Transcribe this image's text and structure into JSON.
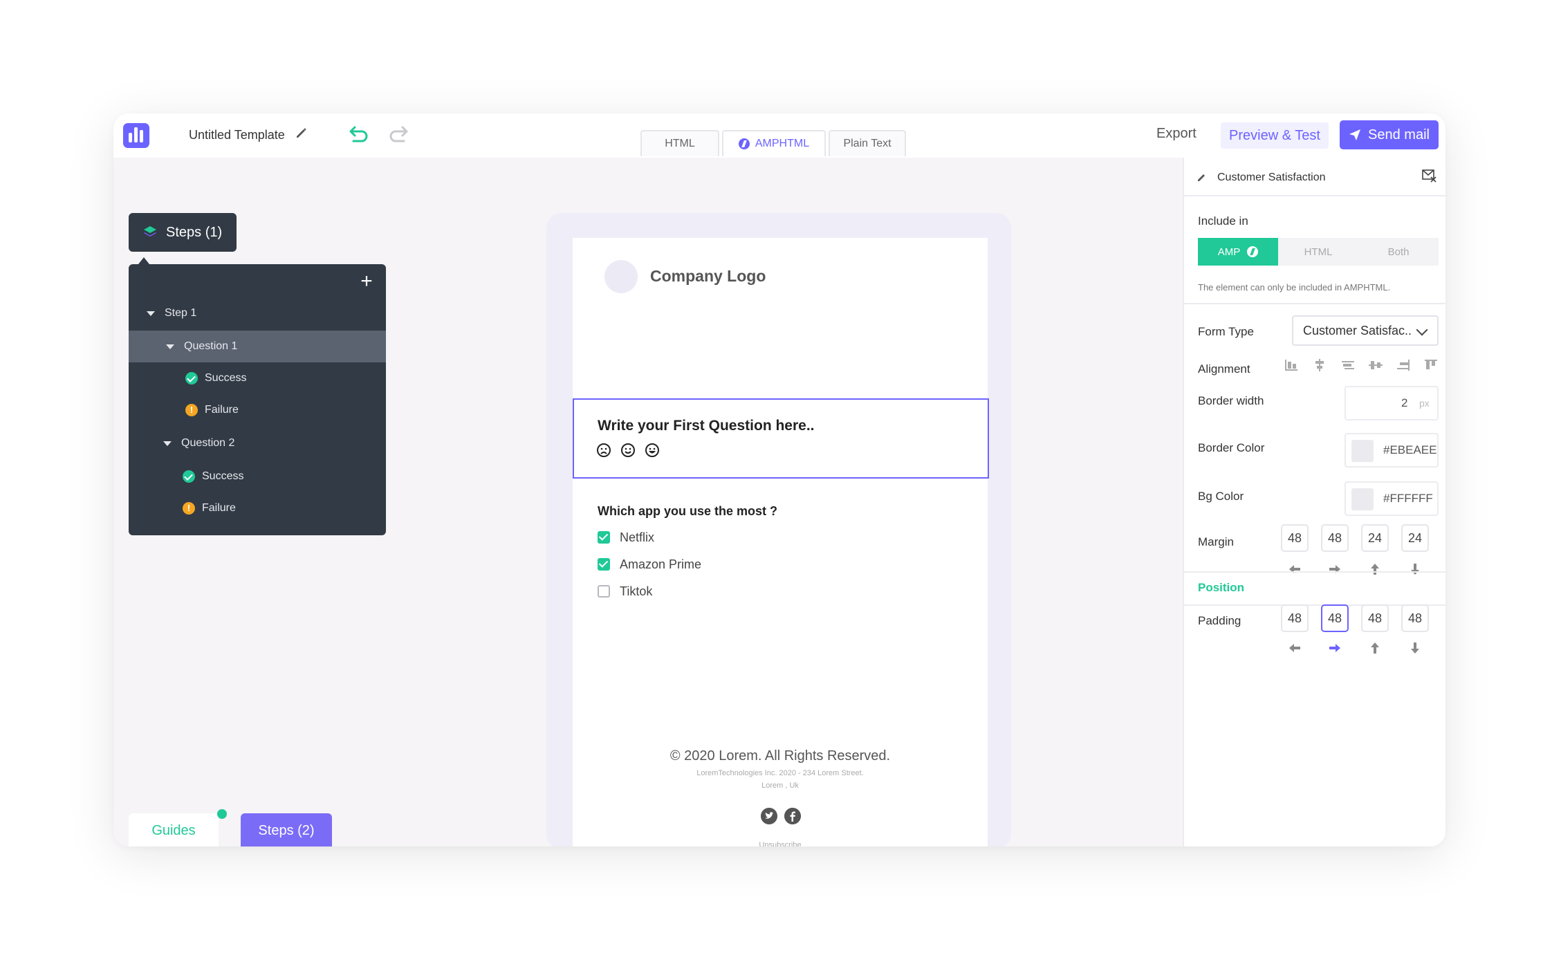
{
  "topbar": {
    "title": "Untitled Template",
    "tabs": [
      "HTML",
      "AMPHTML",
      "Plain Text"
    ],
    "export_label": "Export",
    "preview_label": "Preview & Test",
    "send_label": "Send mail"
  },
  "steps": {
    "header_label": "Steps (1)",
    "tree": {
      "step1": "Step 1",
      "question1": "Question 1",
      "q1_success": "Success",
      "q1_failure": "Failure",
      "question2": "Question 2",
      "q2_success": "Success",
      "q2_failure": "Failure"
    },
    "bottom_tabs": {
      "guides": "Guides",
      "steps": "Steps (2)"
    }
  },
  "email": {
    "company_logo": "Company Logo",
    "question_title": "Write your First Question here..",
    "question2_title": "Which app you use the most ?",
    "options": [
      {
        "label": "Netflix",
        "checked": true
      },
      {
        "label": "Amazon Prime",
        "checked": true
      },
      {
        "label": "Tiktok",
        "checked": false
      }
    ],
    "footer_copy": "© 2020 Lorem. All Rights Reserved.",
    "footer_address": "LoremTechnologies Inc. 2020 - 234 Lorem Street.",
    "footer_city": "Lorem , Uk",
    "unsubscribe": "Unsubscribe"
  },
  "panel": {
    "title": "Customer Satisfaction",
    "include_label": "Include in",
    "include_options": [
      "AMP",
      "HTML",
      "Both"
    ],
    "include_note": "The element can only be included in AMPHTML.",
    "form_type_label": "Form Type",
    "form_type_value": "Customer Satisfac..",
    "alignment_label": "Alignment",
    "border_width_label": "Border width",
    "border_width_value": "2",
    "border_width_unit": "px",
    "border_color_label": "Border Color",
    "border_color_value": "#EBEAEE",
    "bg_color_label": "Bg Color",
    "bg_color_value": "#FFFFFF",
    "margin_label": "Margin",
    "margin_values": [
      "48",
      "48",
      "24",
      "24"
    ],
    "position_label": "Position",
    "padding_label": "Padding",
    "padding_values": [
      "48",
      "48",
      "48",
      "48"
    ]
  },
  "colors": {
    "accent": "#6c63ff",
    "success": "#20c997",
    "warning": "#f5a623",
    "dark_panel": "#323a45"
  }
}
